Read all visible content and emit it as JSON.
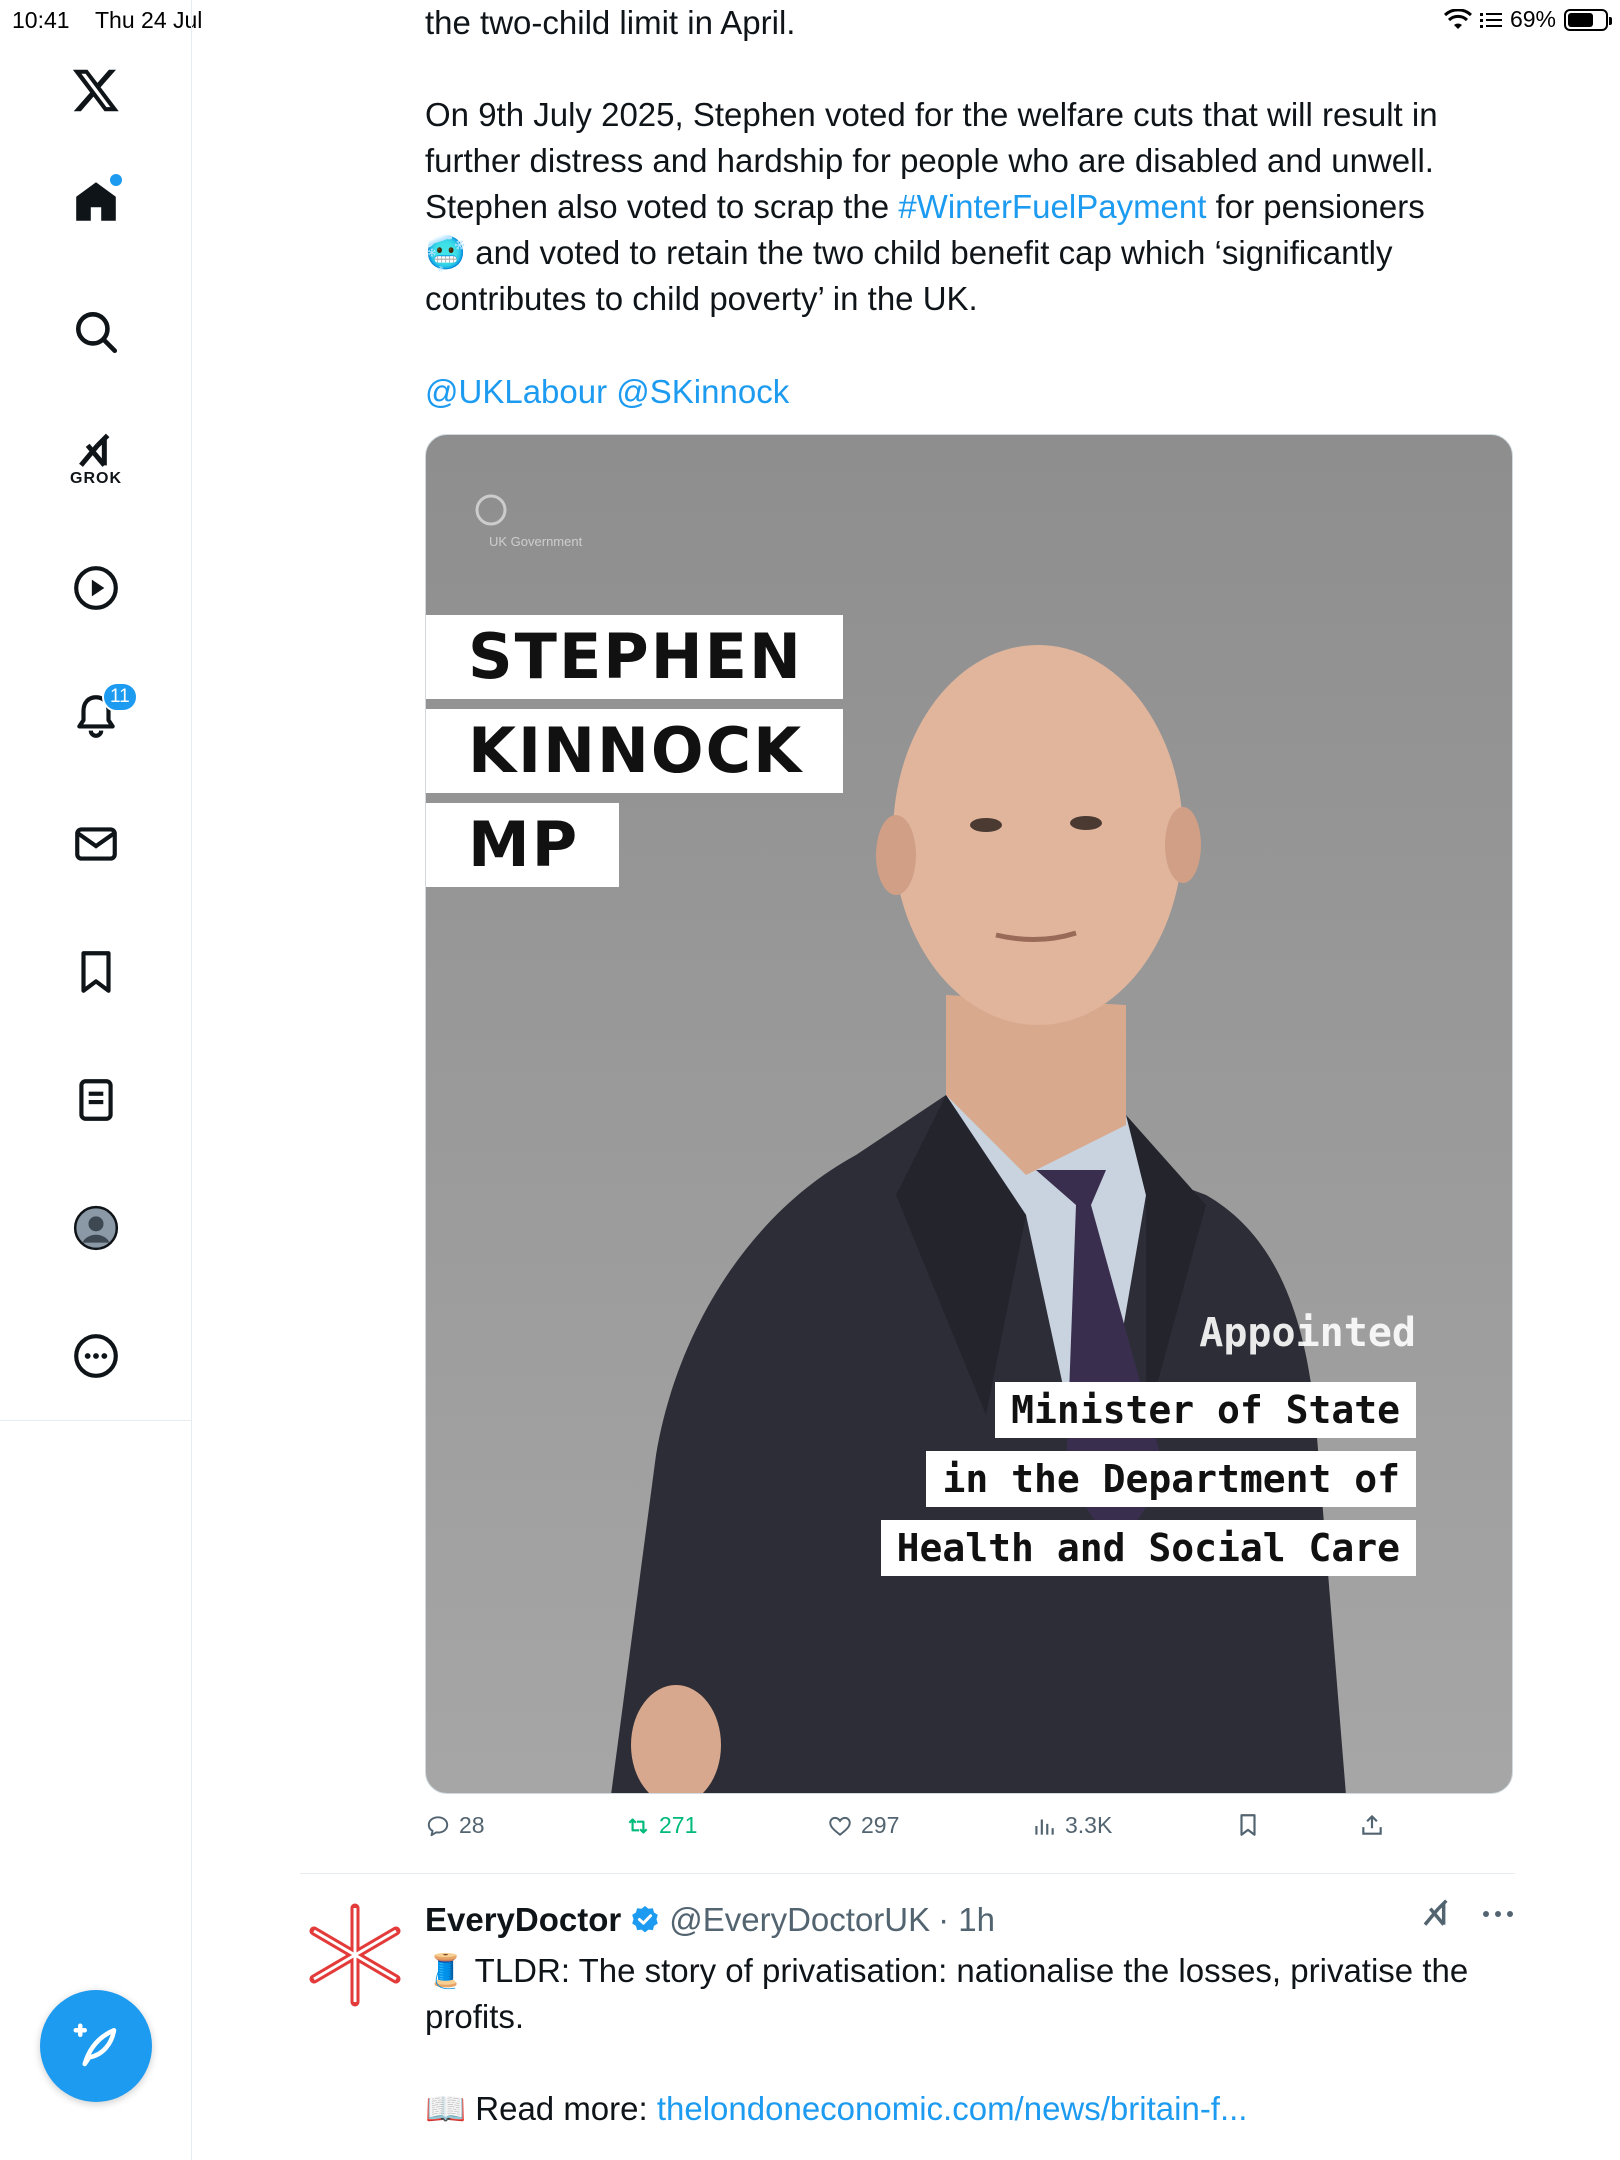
{
  "status_bar": {
    "time": "10:41",
    "date": "Thu 24 Jul",
    "battery": "69%",
    "battery_level": 0.69
  },
  "sidebar": {
    "grok_label": "GROK",
    "notifications_badge": "11",
    "icons": [
      "x-logo-icon",
      "home-icon",
      "search-icon",
      "grok-icon",
      "video-icon",
      "bell-icon",
      "mail-icon",
      "bookmark-icon",
      "lists-icon",
      "profile-icon",
      "more-icon",
      "compose-icon"
    ]
  },
  "tweet": {
    "line_top": "the two-child limit in April.",
    "p1_a": "On 9th July 2025, Stephen voted for the welfare cuts that will result in further distress and hardship for people who are disabled and unwell. Stephen also voted to scrap the ",
    "hashtag": "#WinterFuelPayment",
    "p1_b": " for pensioners",
    "emoji": "🥶",
    "p1_c": " and voted to retain the two child benefit cap which ‘significantly contributes to child poverty’ in the UK.",
    "mention1": "@UKLabour",
    "mention2": "@SKinnock",
    "media": {
      "logo_text": "UK Government",
      "name_line1": "STEPHEN",
      "name_line2": "KINNOCK",
      "name_line3": "MP",
      "appointed": "Appointed",
      "role_line1": "Minister of State",
      "role_line2": "in the Department of",
      "role_line3": "Health and Social Care"
    },
    "stats": {
      "replies": "28",
      "reposts": "271",
      "likes": "297",
      "views": "3.3K"
    },
    "colors": {
      "accent": "#1d9bf0",
      "repost": "#00ba7c",
      "muted": "#536471"
    }
  },
  "tweet2": {
    "display_name": "EveryDoctor",
    "handle": "@EveryDoctorUK",
    "time": "· 1h",
    "emoji1": "🧵",
    "text1": " TLDR: The story of privatisation: nationalise the losses, privatise the profits.",
    "emoji2": "📖",
    "read_more_label": " Read more: ",
    "link": "thelondoneconomic.com/news/britain-f..."
  }
}
